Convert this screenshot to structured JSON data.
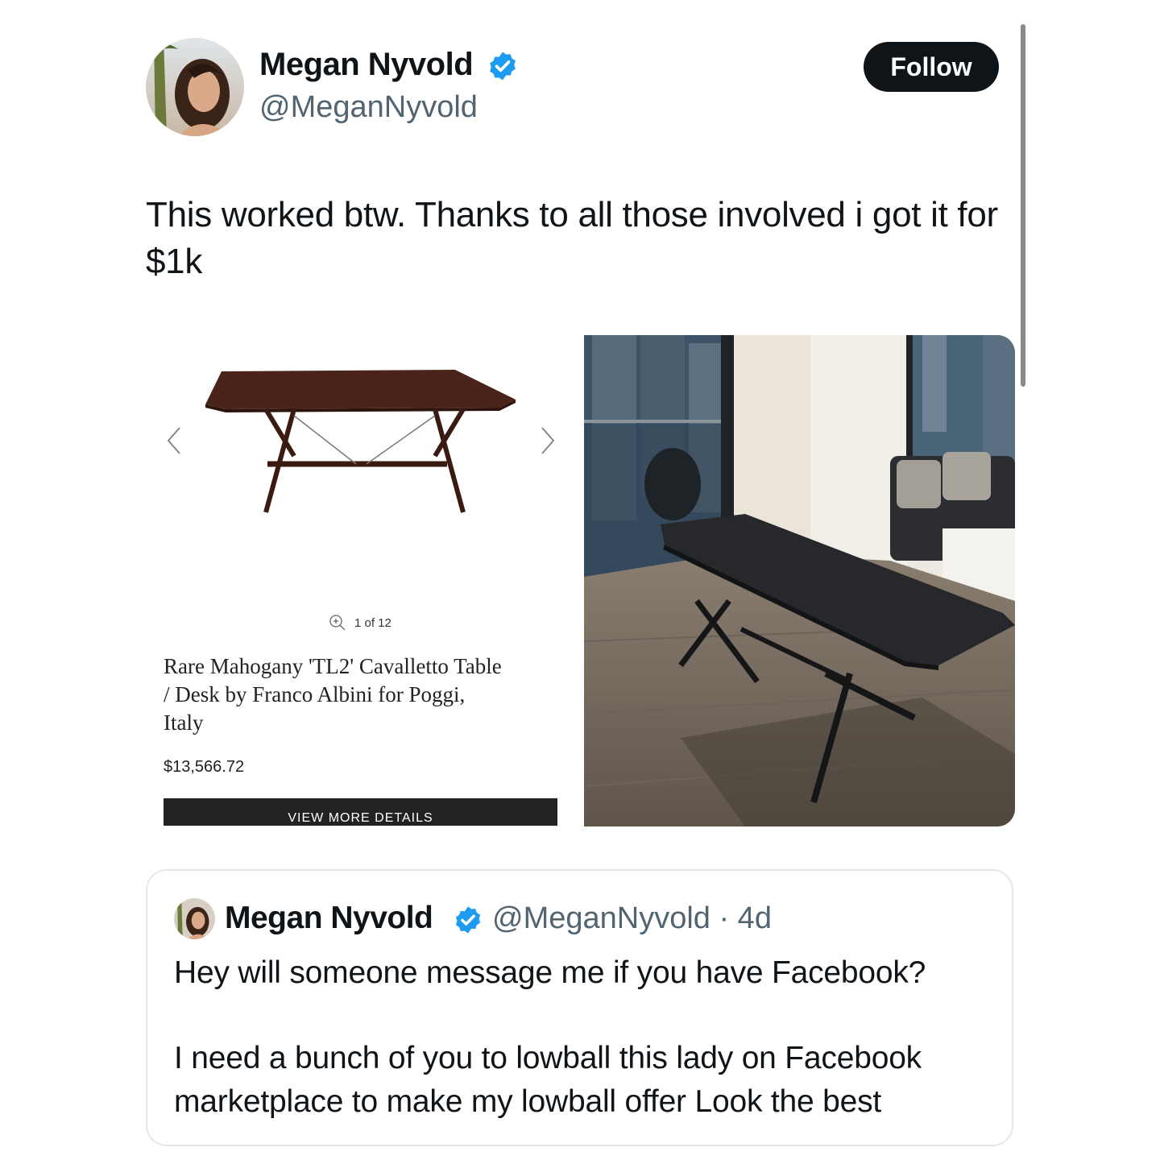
{
  "author": {
    "name": "Megan Nyvold",
    "handle": "@MeganNyvold",
    "avatar_icon": "profile-photo",
    "verified_icon": "verified-badge-icon",
    "verified_color": "#1d9bf0"
  },
  "actions": {
    "follow_label": "Follow"
  },
  "tweet": {
    "text": "This worked btw. Thanks to all those involved i got it for $1k"
  },
  "media": {
    "listing": {
      "counter": "1 of 12",
      "title": "Rare Mahogany 'TL2' Cavalletto Table / Desk by Franco Albini for Poggi, Italy",
      "price": "$13,566.72",
      "details_label": "VIEW MORE DETAILS",
      "prev_icon": "chevron-left-icon",
      "next_icon": "chevron-right-icon",
      "zoom_icon": "zoom-in-icon"
    }
  },
  "quoted": {
    "name": "Megan Nyvold",
    "handle_time": "@MeganNyvold · 4d",
    "paragraph1": "Hey will someone message me if you have Facebook?",
    "paragraph2": "I need a bunch of you to lowball this lady on Facebook marketplace to make my lowball offer Look the best"
  },
  "colors": {
    "text": "#0f1419",
    "secondary": "#536471",
    "follow_bg": "#0f1419",
    "border": "#e4e8eb"
  }
}
